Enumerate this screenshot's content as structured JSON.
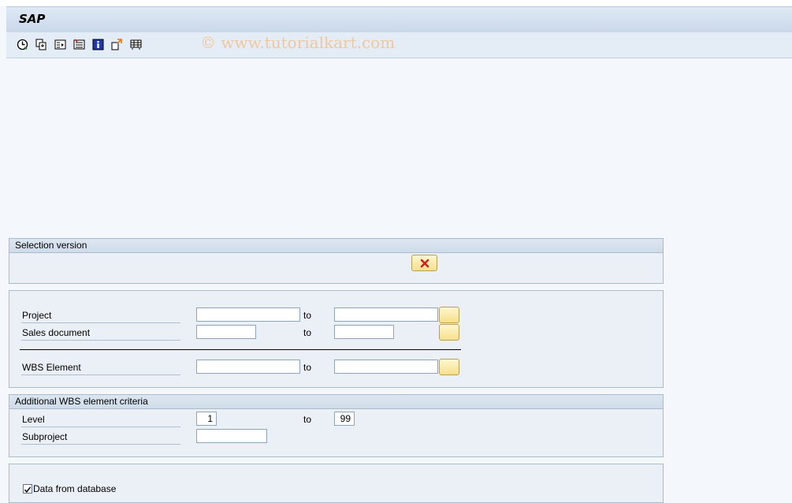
{
  "app": {
    "title": "SAP"
  },
  "watermark": "© www.tutorialkart.com",
  "toolbar": {
    "icons": [
      "execute-icon",
      "copy-icon",
      "selection-options-icon",
      "delete-selection-icon",
      "info-icon",
      "get-variant-icon",
      "save-variant-icon"
    ]
  },
  "selection_version": {
    "title": "Selection version",
    "delete_icon": "red-x-icon"
  },
  "main_block": {
    "project": {
      "label": "Project",
      "from": "",
      "to_label": "to",
      "to": ""
    },
    "sales_document": {
      "label": "Sales document",
      "from": "",
      "to_label": "to",
      "to": ""
    },
    "wbs_element": {
      "label": "WBS Element",
      "from": "",
      "to_label": "to",
      "to": ""
    }
  },
  "additional_wbs": {
    "title": "Additional WBS element criteria",
    "level": {
      "label": "Level",
      "from": "1",
      "to_label": "to",
      "to": "99"
    },
    "subproject": {
      "label": "Subproject",
      "value": ""
    }
  },
  "options": {
    "data_from_database": {
      "label": "Data from database",
      "checked": true
    }
  },
  "colors": {
    "title_bar": "#c9d8ea",
    "panel_bg": "#eaf0f6",
    "button_yellow": "#f6e08a",
    "delete_red": "#d02020"
  }
}
